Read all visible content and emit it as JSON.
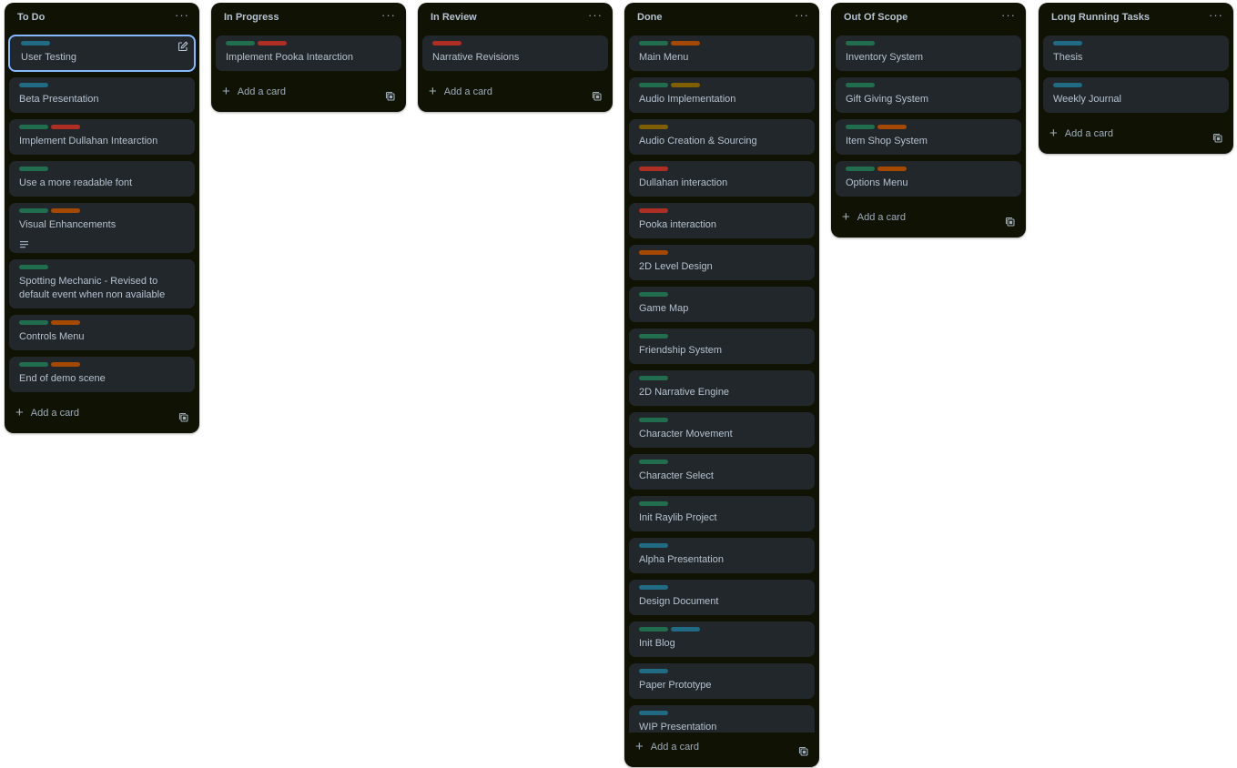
{
  "colors": {
    "list_bg": "#101204",
    "card_bg": "#22272b",
    "text": "#b6c2cf",
    "muted": "#9fadbc",
    "focus_outline": "#85b8ff"
  },
  "label_colors": {
    "green": "#216e4e",
    "red": "#ae2e24",
    "orange": "#a54800",
    "blue": "#206a83",
    "yellow": "#7f5f01"
  },
  "add_card_label": "Add a card",
  "lists": [
    {
      "title": "To Do",
      "cards": [
        {
          "title": "User Testing",
          "labels": [
            "blue"
          ],
          "focused": true
        },
        {
          "title": "Beta Presentation",
          "labels": [
            "blue"
          ]
        },
        {
          "title": "Implement Dullahan Intearction",
          "labels": [
            "green",
            "red"
          ]
        },
        {
          "title": "Use a more readable font",
          "labels": [
            "green"
          ]
        },
        {
          "title": "Visual Enhancements",
          "labels": [
            "green",
            "orange"
          ],
          "description_icon": true
        },
        {
          "title": "Spotting Mechanic - Revised to default event when non available",
          "labels": [
            "green"
          ]
        },
        {
          "title": "Controls Menu",
          "labels": [
            "green",
            "orange"
          ]
        },
        {
          "title": "End of demo scene",
          "labels": [
            "green",
            "orange"
          ]
        }
      ]
    },
    {
      "title": "In Progress",
      "cards": [
        {
          "title": "Implement Pooka Intearction",
          "labels": [
            "green",
            "red"
          ]
        }
      ]
    },
    {
      "title": "In Review",
      "cards": [
        {
          "title": "Narrative Revisions",
          "labels": [
            "red"
          ]
        }
      ]
    },
    {
      "title": "Done",
      "cards": [
        {
          "title": "Main Menu",
          "labels": [
            "green",
            "orange"
          ]
        },
        {
          "title": "Audio Implementation",
          "labels": [
            "green",
            "yellow"
          ]
        },
        {
          "title": "Audio Creation & Sourcing",
          "labels": [
            "yellow"
          ]
        },
        {
          "title": "Dullahan interaction",
          "labels": [
            "red"
          ]
        },
        {
          "title": "Pooka interaction",
          "labels": [
            "red"
          ]
        },
        {
          "title": "2D Level Design",
          "labels": [
            "orange"
          ]
        },
        {
          "title": "Game Map",
          "labels": [
            "green"
          ]
        },
        {
          "title": "Friendship System",
          "labels": [
            "green"
          ]
        },
        {
          "title": "2D Narrative Engine",
          "labels": [
            "green"
          ]
        },
        {
          "title": "Character Movement",
          "labels": [
            "green"
          ]
        },
        {
          "title": "Character Select",
          "labels": [
            "green"
          ]
        },
        {
          "title": "Init Raylib Project",
          "labels": [
            "green"
          ]
        },
        {
          "title": "Alpha Presentation",
          "labels": [
            "blue"
          ]
        },
        {
          "title": "Design Document",
          "labels": [
            "blue"
          ]
        },
        {
          "title": "Init Blog",
          "labels": [
            "green",
            "blue"
          ]
        },
        {
          "title": "Paper Prototype",
          "labels": [
            "blue"
          ]
        },
        {
          "title": "WIP Presentation",
          "labels": [
            "blue"
          ]
        }
      ]
    },
    {
      "title": "Out Of Scope",
      "cards": [
        {
          "title": "Inventory System",
          "labels": [
            "green"
          ]
        },
        {
          "title": "Gift Giving System",
          "labels": [
            "green"
          ]
        },
        {
          "title": "Item Shop System",
          "labels": [
            "green",
            "orange"
          ]
        },
        {
          "title": "Options Menu",
          "labels": [
            "green",
            "orange"
          ]
        }
      ]
    },
    {
      "title": "Long Running Tasks",
      "cards": [
        {
          "title": "Thesis",
          "labels": [
            "blue"
          ]
        },
        {
          "title": "Weekly Journal",
          "labels": [
            "blue"
          ]
        }
      ]
    }
  ]
}
